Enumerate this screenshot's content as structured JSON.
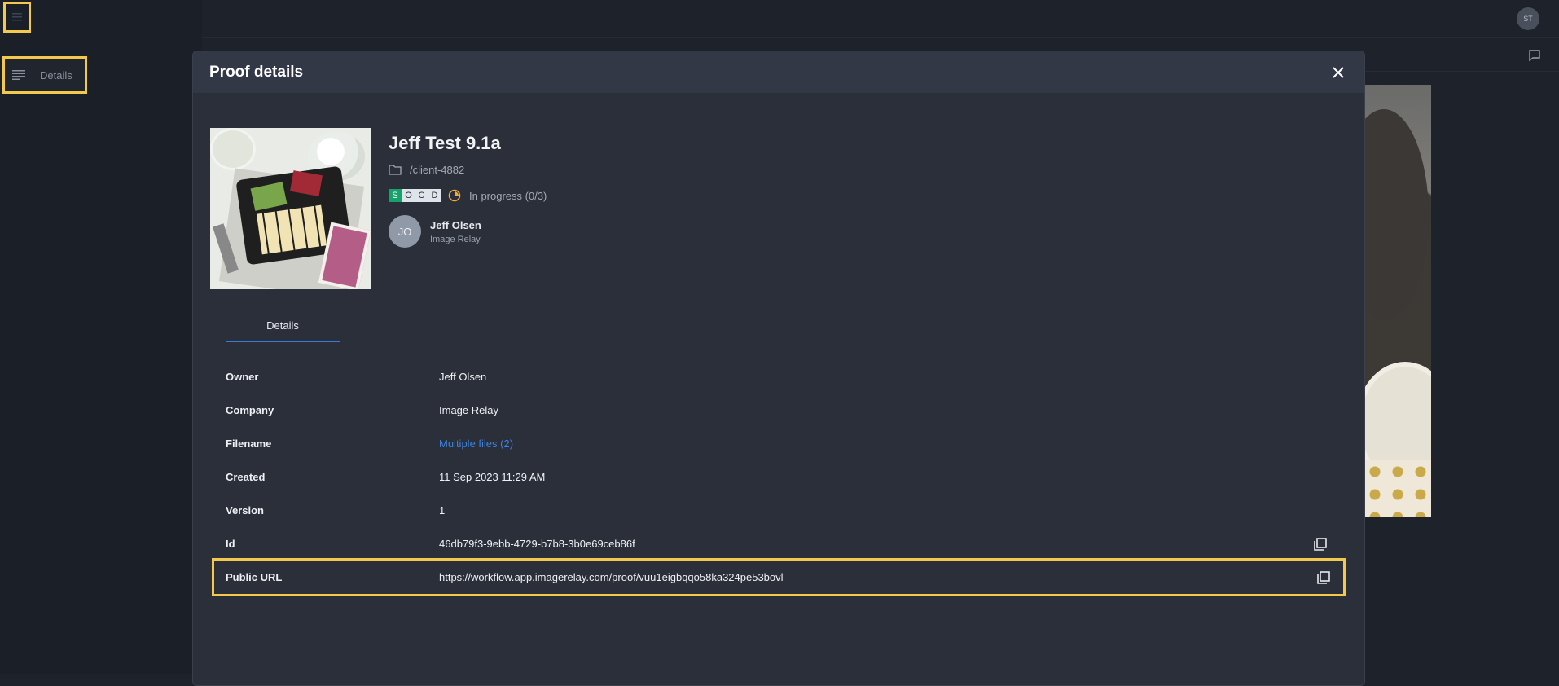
{
  "app": {
    "left_tab_label": "Details",
    "user_initials": "ST"
  },
  "modal": {
    "title": "Proof details",
    "proof_name": "Jeff Test 9.1a",
    "folder": "/client-4882",
    "steps": [
      "S",
      "O",
      "C",
      "D"
    ],
    "status": "In progress (0/3)",
    "owner_initials": "JO",
    "owner_name": "Jeff Olsen",
    "owner_company": "Image Relay",
    "tab_details": "Details",
    "fields": {
      "owner_label": "Owner",
      "owner_value": "Jeff Olsen",
      "company_label": "Company",
      "company_value": "Image Relay",
      "filename_label": "Filename",
      "filename_value": "Multiple files (2)",
      "created_label": "Created",
      "created_value": "11 Sep 2023 11:29 AM",
      "version_label": "Version",
      "version_value": "1",
      "id_label": "Id",
      "id_value": "46db79f3-9ebb-4729-b7b8-3b0e69ceb86f",
      "url_label": "Public URL",
      "url_value": "https://workflow.app.imagerelay.com/proof/vuu1eigbqqo58ka324pe53bovl"
    }
  },
  "colors": {
    "accent": "#3a7bd5",
    "highlight": "#f2c94c",
    "step_done": "#14a36a",
    "status_in_progress": "#f2a93b"
  }
}
